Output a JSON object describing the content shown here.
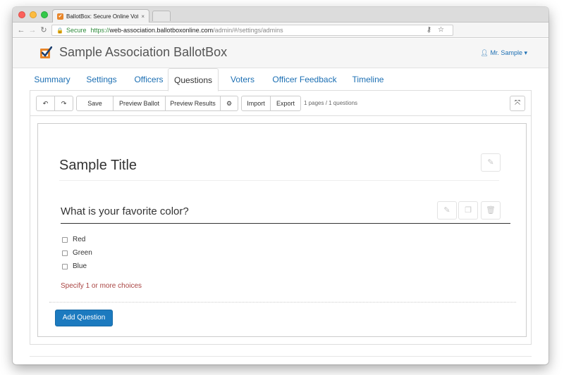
{
  "browser": {
    "tab_title": "BallotBox: Secure Online Votin",
    "tab_close": "×",
    "security_label": "Secure",
    "url_protocol": "https://",
    "url_host": "web-association.ballotboxonline.com",
    "url_path": "/admin/#/settings/admins"
  },
  "header": {
    "site_title": "Sample Association BallotBox",
    "user_name": "Mr. Sample",
    "brand_color": "#e8862a"
  },
  "tabs": [
    {
      "label": "Summary",
      "active": false
    },
    {
      "label": "Settings",
      "active": false
    },
    {
      "label": "Officers",
      "active": false
    },
    {
      "label": "Questions",
      "active": true
    },
    {
      "label": "Voters",
      "active": false
    },
    {
      "label": "Officer Feedback",
      "active": false
    },
    {
      "label": "Timeline",
      "active": false
    }
  ],
  "toolbar": {
    "undo_icon": "undo-icon",
    "redo_icon": "redo-icon",
    "save_label": "Save",
    "preview_ballot_label": "Preview Ballot",
    "preview_results_label": "Preview Results",
    "settings_icon": "gear-icon",
    "import_label": "Import",
    "export_label": "Export",
    "page_info": "1 pages / 1 questions",
    "expand_icon": "expand-icon"
  },
  "ballot": {
    "title": "Sample Title",
    "question": {
      "text": "What is your favorite color?",
      "choices": [
        "Red",
        "Green",
        "Blue"
      ],
      "hint": "Specify 1 or more choices"
    },
    "add_question_label": "Add Question"
  },
  "colors": {
    "link": "#1c6fb3",
    "primary_button": "#1c7abf",
    "hint": "#a94442",
    "secure": "#2e8b3b"
  }
}
